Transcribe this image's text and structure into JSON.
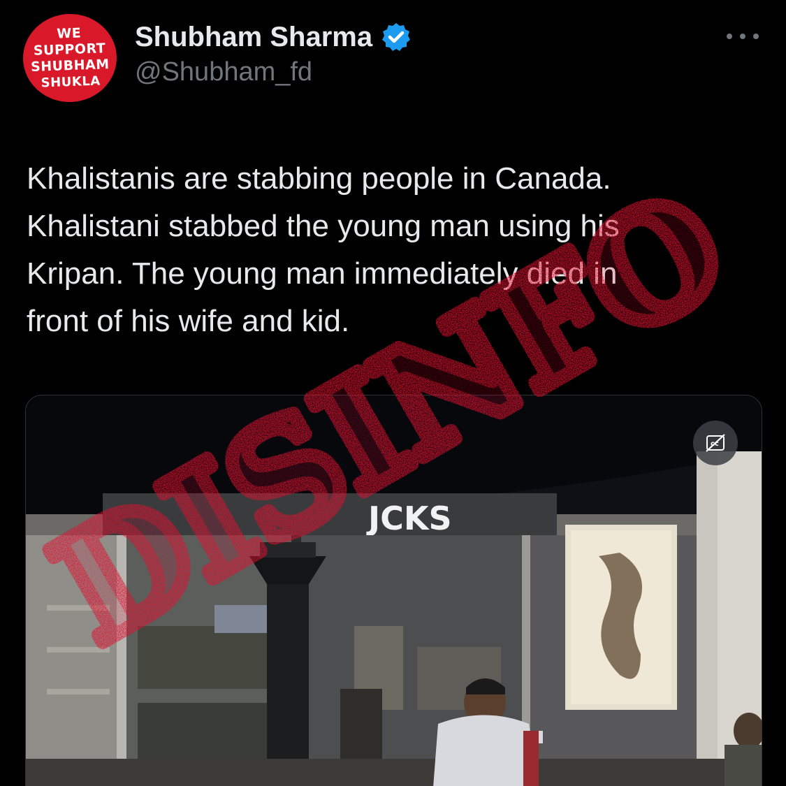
{
  "avatar": {
    "lines": [
      "WE",
      "SUPPORT",
      "SHUBHAM",
      "SHUKLA"
    ],
    "bg_color": "#d9182a"
  },
  "user": {
    "display_name": "Shubham Sharma",
    "handle": "@Shubham_fd",
    "verified_icon": "verified-badge-icon",
    "verified_color": "#1d9bf0"
  },
  "more_icon": "more-horizontal-icon",
  "tweet": {
    "lines": [
      "Khalistanis are stabbing people in Canada.",
      "Khalistani stabbed the young man using his",
      "Kripan. The young man immediately died in",
      "front of his wife and kid."
    ]
  },
  "media": {
    "storefront_sign": "JCKS",
    "captions_icon": "closed-captions-off-icon"
  },
  "stamp": {
    "text": "DISINFO",
    "color": "#e0102f"
  }
}
